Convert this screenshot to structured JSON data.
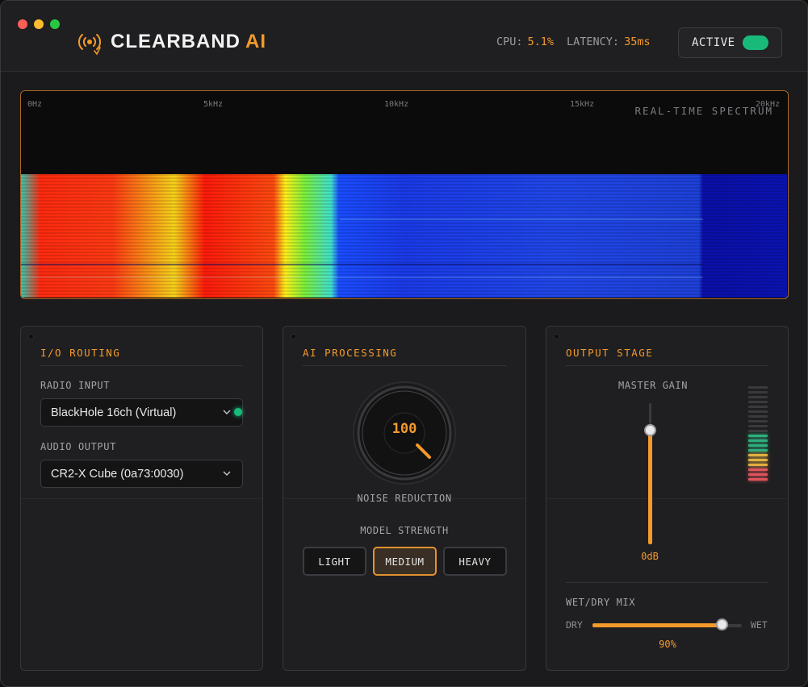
{
  "app": {
    "brand_main": "CLEARBAND",
    "brand_accent": "AI"
  },
  "header": {
    "cpu_label": "CPU:",
    "cpu_value": "5.1%",
    "latency_label": "LATENCY:",
    "latency_value": "35ms",
    "active_label": "ACTIVE",
    "active_on": true
  },
  "spectrum": {
    "title": "REAL-TIME SPECTRUM",
    "freq_labels": [
      "0Hz",
      "5kHz",
      "10kHz",
      "15kHz",
      "20kHz"
    ]
  },
  "io_routing": {
    "title": "I/O ROUTING",
    "radio_input_label": "RADIO INPUT",
    "radio_input_value": "BlackHole 16ch (Virtual)",
    "audio_output_label": "AUDIO OUTPUT",
    "audio_output_value": "CR2-X Cube (0a73:0030)"
  },
  "ai_processing": {
    "title": "AI PROCESSING",
    "noise_reduction_value": "100",
    "noise_reduction_label": "NOISE REDUCTION",
    "model_strength_label": "MODEL STRENGTH",
    "strength_options": [
      "LIGHT",
      "MEDIUM",
      "HEAVY"
    ],
    "selected_strength": "MEDIUM"
  },
  "output_stage": {
    "title": "OUTPUT STAGE",
    "master_gain_label": "MASTER GAIN",
    "master_gain_value": "0dB",
    "master_gain_fraction": 0.83,
    "meter_lit_segments": 10,
    "meter_total_segments": 20,
    "wet_dry_label": "WET/DRY MIX",
    "dry_label": "DRY",
    "wet_label": "WET",
    "mix_value": "90%",
    "mix_fraction": 0.9
  },
  "colors": {
    "accent": "#f39a2b",
    "active_green": "#19b97a"
  }
}
